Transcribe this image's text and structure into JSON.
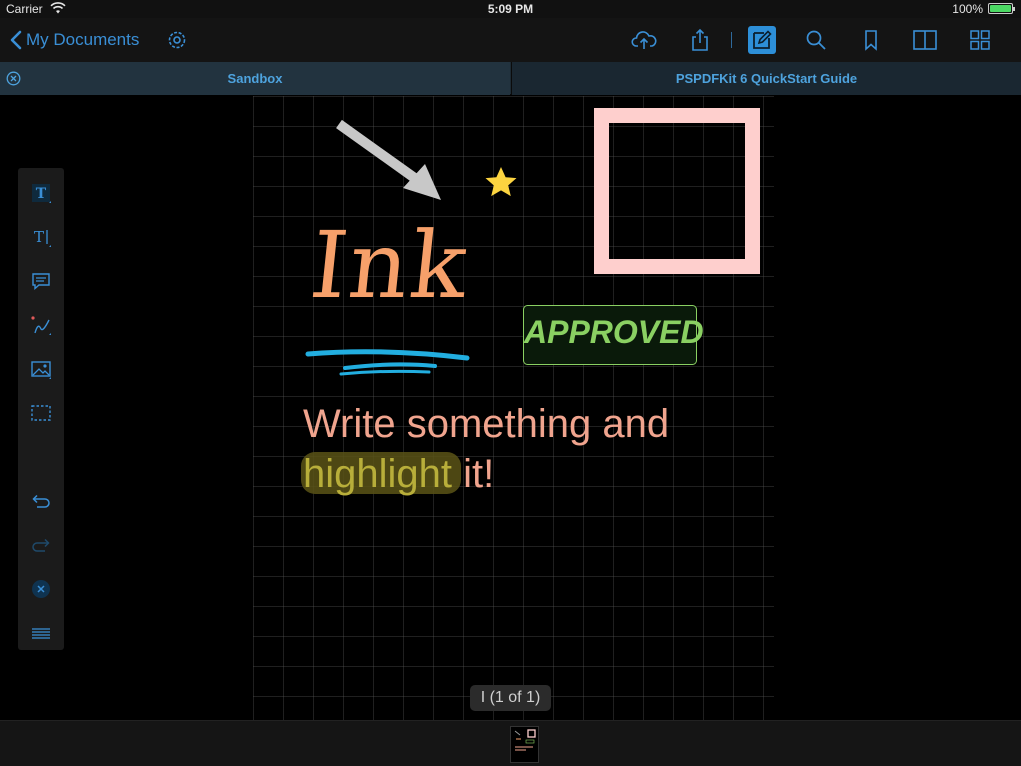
{
  "status_bar": {
    "carrier": "Carrier",
    "time": "5:09 PM",
    "battery_percent": "100%",
    "battery_level": 1.0
  },
  "nav_bar": {
    "back_label": "My Documents",
    "icons": [
      "settings-icon",
      "cloud-upload-icon",
      "share-icon",
      "annotate-icon",
      "search-icon",
      "bookmark-icon",
      "reader-view-icon",
      "thumbnails-grid-icon"
    ],
    "accent_color": "#2d8fd8"
  },
  "tabs": [
    {
      "label": "Sandbox",
      "selected": true
    },
    {
      "label": "PSPDFKit 6 QuickStart Guide",
      "selected": false
    }
  ],
  "document": {
    "ink_text": "Ink",
    "stamp_text": "APPROVED",
    "line1": "Write something and",
    "line2_highlighted": "highlight",
    "line2_rest": " it!",
    "colors": {
      "ink": "#f6a06a",
      "underline": "#22aee0",
      "square": "#fecfcd",
      "stamp_text": "#8ad062",
      "star": "#fcd440",
      "arrow": "#c8c8c8",
      "text": "#f0a48e",
      "highlight": "#5a5416"
    }
  },
  "annotation_toolbar": {
    "tools": [
      "free-text-icon",
      "text-callout-icon",
      "note-icon",
      "ink-pen-icon",
      "image-icon",
      "selection-icon",
      "undo-icon",
      "redo-icon",
      "close-icon",
      "more-menu-icon"
    ]
  },
  "page_label": "I (1 of 1)"
}
